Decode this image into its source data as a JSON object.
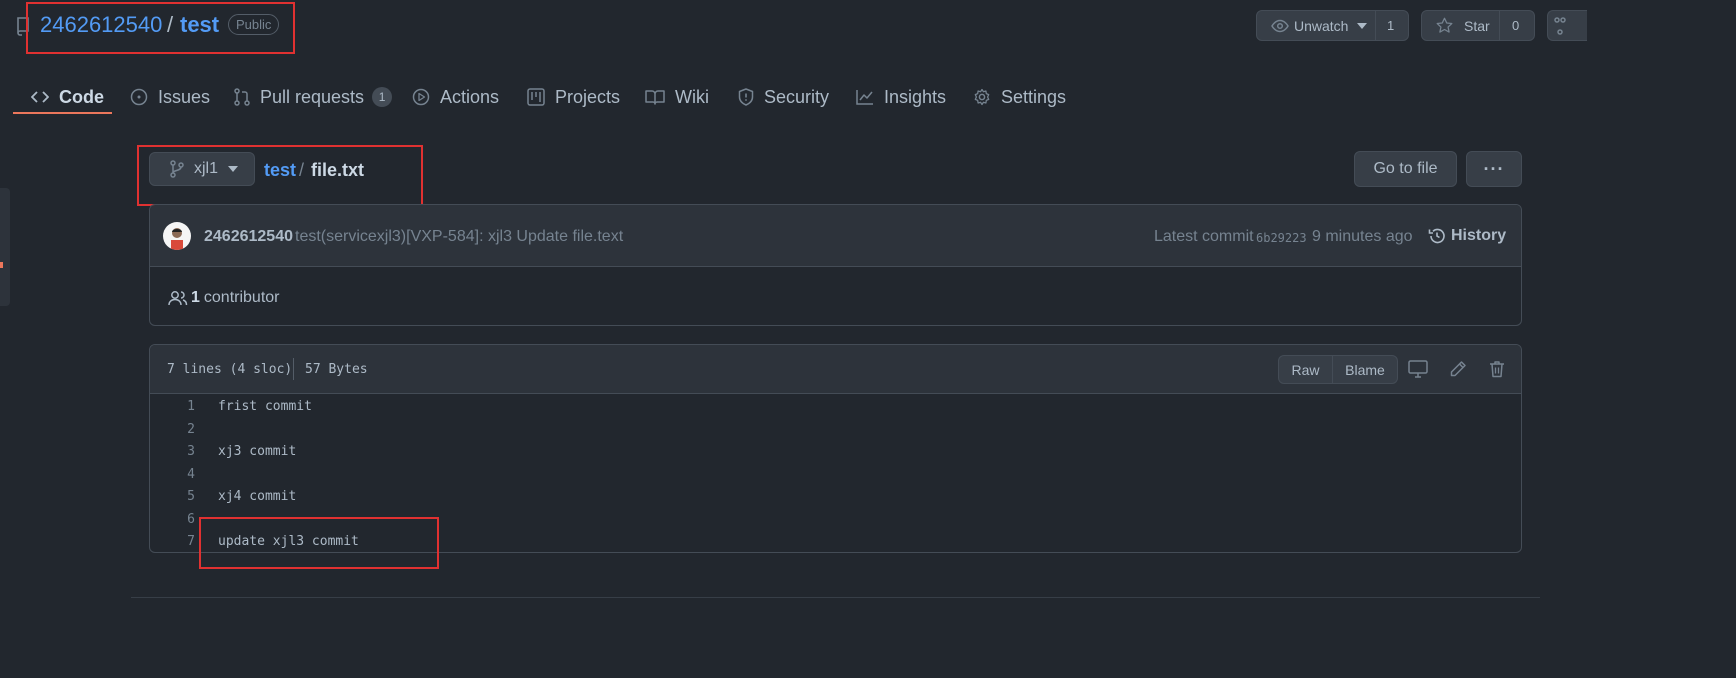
{
  "repo": {
    "owner": "2462612540",
    "separator": "/",
    "name": "test",
    "visibility": "Public"
  },
  "header_actions": {
    "unwatch_label": "Unwatch",
    "watch_count": "1",
    "star_label": "Star",
    "star_count": "0"
  },
  "tabs": [
    {
      "label": "Code",
      "icon": "code-icon",
      "active": true
    },
    {
      "label": "Issues",
      "icon": "issue-icon"
    },
    {
      "label": "Pull requests",
      "icon": "pull-request-icon",
      "badge": "1"
    },
    {
      "label": "Actions",
      "icon": "play-icon"
    },
    {
      "label": "Projects",
      "icon": "project-icon"
    },
    {
      "label": "Wiki",
      "icon": "book-icon"
    },
    {
      "label": "Security",
      "icon": "shield-icon"
    },
    {
      "label": "Insights",
      "icon": "graph-icon"
    },
    {
      "label": "Settings",
      "icon": "gear-icon"
    }
  ],
  "branch": {
    "name": "xjl1"
  },
  "path": {
    "dir": "test",
    "separator": "/",
    "file": "file.txt"
  },
  "go_to_file": "Go to file",
  "more_label": "···",
  "commit": {
    "author": "2462612540",
    "message": "test(servicexjl3)[VXP-584]: xjl3 Update file.text",
    "latest_label": "Latest commit",
    "sha": "6b29223",
    "time": "9 minutes ago",
    "history_label": "History"
  },
  "contributors": {
    "count": "1",
    "label": "contributor"
  },
  "file_info": {
    "lines": "7 lines (4 sloc)",
    "size": "57 Bytes"
  },
  "file_actions": {
    "raw": "Raw",
    "blame": "Blame"
  },
  "code_lines": [
    {
      "num": "1",
      "text": "frist commit"
    },
    {
      "num": "2",
      "text": ""
    },
    {
      "num": "3",
      "text": "xj3 commit"
    },
    {
      "num": "4",
      "text": ""
    },
    {
      "num": "5",
      "text": "xj4 commit"
    },
    {
      "num": "6",
      "text": ""
    },
    {
      "num": "7",
      "text": "update xjl3 commit"
    }
  ],
  "colors": {
    "background": "#22272e",
    "link": "#539bf5",
    "accent": "#ec775c",
    "highlight_box": "#e03131"
  }
}
